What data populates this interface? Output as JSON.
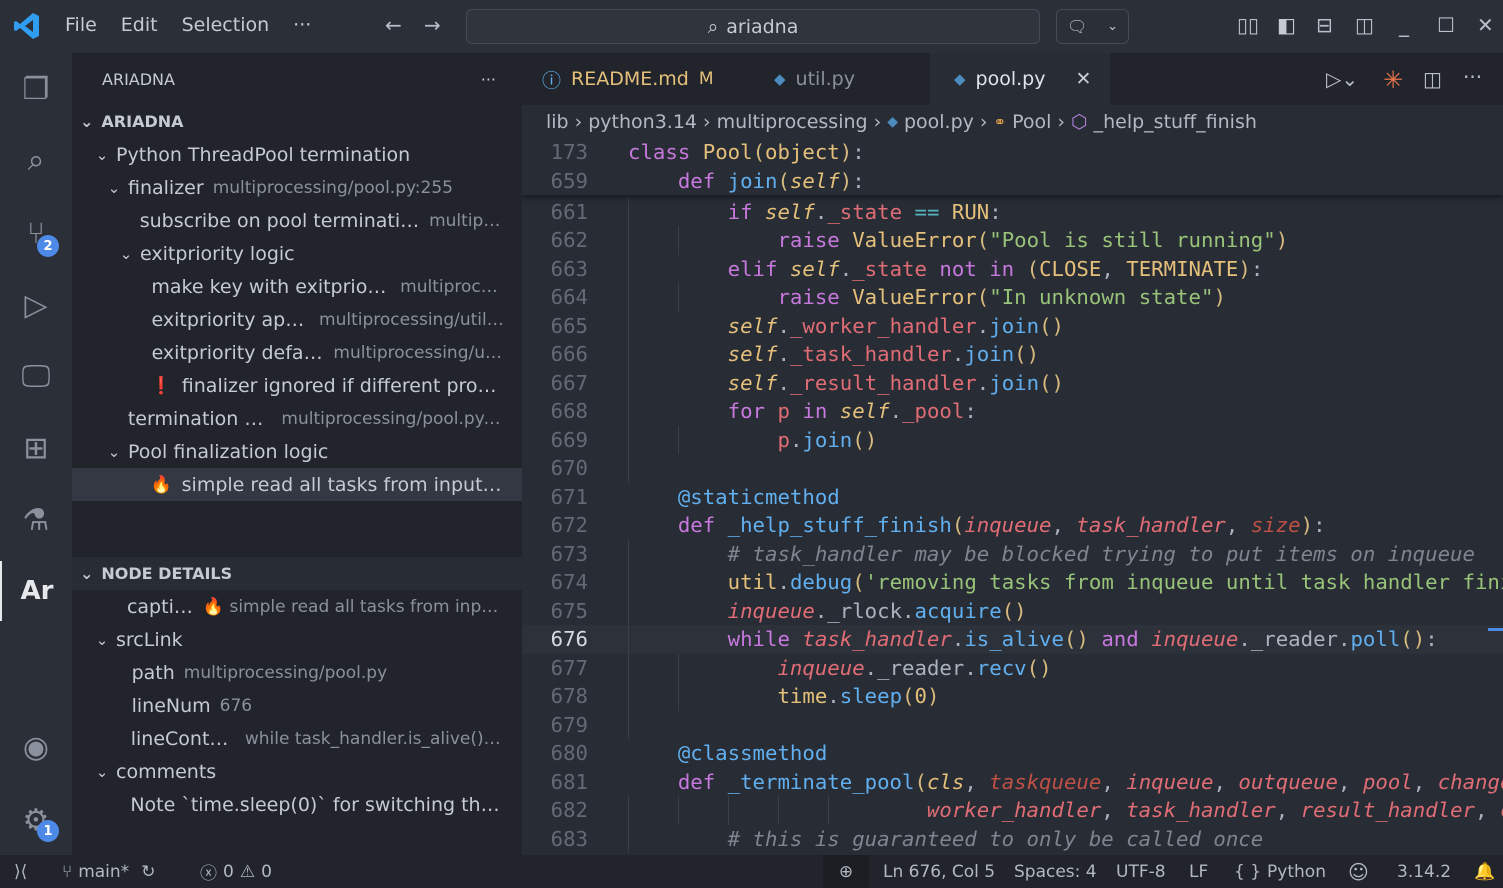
{
  "titlebar": {
    "menus": [
      "File",
      "Edit",
      "Selection"
    ],
    "more": "···",
    "search": "ariadna"
  },
  "colors": {
    "accent": "#4d8ae8",
    "editor_bg": "#282c34",
    "sidebar_bg": "#21252b",
    "readme_modified": "#e5c07b",
    "claude_icon": "#e8744a"
  },
  "activity": {
    "items": [
      "explorer-icon",
      "search-icon",
      "source-control-icon",
      "run-debug-icon",
      "remote-explorer-icon",
      "extensions-icon",
      "testing-icon",
      "ariadna-icon"
    ],
    "scm_badge": "2",
    "ariadna_label": "Ar",
    "settings_badge": "1"
  },
  "sidebar": {
    "title": "ARIADNA",
    "more": "···",
    "section1": "ARIADNA",
    "tree": [
      {
        "label": "Python ThreadPool termination",
        "desc": "",
        "level": 0,
        "expanded": true
      },
      {
        "label": "finalizer",
        "desc": "multiprocessing/pool.py:255",
        "level": 1,
        "expanded": true
      },
      {
        "label": "subscribe on pool termination",
        "desc": "multipr...",
        "level": 2
      },
      {
        "label": "exitpriority logic",
        "desc": "",
        "level": 2,
        "expanded": true
      },
      {
        "label": "make key with exitpriority",
        "desc": "multiproce...",
        "level": 3
      },
      {
        "label": "exitpriority apply",
        "desc": "multiprocessing/util....",
        "level": 3
      },
      {
        "label": "exitpriority default",
        "desc": "multiprocessing/ut...",
        "level": 3
      },
      {
        "label": "finalizer ignored if different proces...",
        "desc": "",
        "level": 3,
        "icon": "❗"
      },
      {
        "label": "termination api",
        "desc": "multiprocessing/pool.py:...",
        "level": 1
      },
      {
        "label": "Pool finalization logic",
        "desc": "",
        "level": 1,
        "expanded": true
      },
      {
        "label": "simple read all tasks from input qu...",
        "desc": "",
        "level": 3,
        "icon": "🔥",
        "selected": true
      }
    ],
    "section2": "NODE DETAILS",
    "details": [
      {
        "label": "caption",
        "desc": "🔥 simple read all tasks from input ...",
        "level": 1
      },
      {
        "label": "srcLink",
        "desc": "",
        "level": 0,
        "expanded": true
      },
      {
        "label": "path",
        "desc": "multiprocessing/pool.py",
        "level": 1.3
      },
      {
        "label": "lineNum",
        "desc": "676",
        "level": 1.3
      },
      {
        "label": "lineContent",
        "desc": "while task_handler.is_alive() a...",
        "level": 1.3
      },
      {
        "label": "comments",
        "desc": "",
        "level": 0,
        "expanded": true
      },
      {
        "label": "Note `time.sleep(0)` for switching threa...",
        "desc": "",
        "level": 1.3
      }
    ]
  },
  "tabs": [
    {
      "label": "README.md",
      "badge": "M",
      "icon": "ⓘ"
    },
    {
      "label": "util.py",
      "icon": "python"
    },
    {
      "label": "pool.py",
      "icon": "python",
      "active": true,
      "close": "✕"
    }
  ],
  "breadcrumb": [
    "lib",
    "python3.14",
    "multiprocessing",
    "pool.py",
    "Pool",
    "_help_stuff_finish"
  ],
  "editor": {
    "current_line": "676",
    "sticky": [
      {
        "n": "173",
        "t": [
          [
            "class ",
            "k"
          ],
          [
            "Pool",
            "c"
          ],
          [
            "(",
            "b"
          ],
          [
            "object",
            "c"
          ],
          [
            ")",
            "b"
          ],
          [
            ":",
            "p"
          ]
        ]
      },
      {
        "n": "659",
        "t": [
          [
            "    def ",
            "k"
          ],
          [
            "join",
            "f"
          ],
          [
            "(",
            "b"
          ],
          [
            "self",
            "si"
          ],
          [
            ")",
            "b"
          ],
          [
            ":",
            "p"
          ]
        ]
      }
    ],
    "lines": [
      {
        "n": "661",
        "t": [
          [
            "        if ",
            "k"
          ],
          [
            "self",
            "si"
          ],
          [
            ".",
            "p"
          ],
          [
            "_state",
            "v"
          ],
          [
            " == ",
            "o"
          ],
          [
            "RUN",
            "c"
          ],
          [
            ":",
            "p"
          ]
        ]
      },
      {
        "n": "662",
        "t": [
          [
            "            raise ",
            "k"
          ],
          [
            "ValueError",
            "c"
          ],
          [
            "(",
            "b"
          ],
          [
            "\"Pool is still running\"",
            "s"
          ],
          [
            ")",
            "b"
          ]
        ]
      },
      {
        "n": "663",
        "t": [
          [
            "        elif ",
            "k"
          ],
          [
            "self",
            "si"
          ],
          [
            ".",
            "p"
          ],
          [
            "_state",
            "v"
          ],
          [
            " not in ",
            "k"
          ],
          [
            "(",
            "b"
          ],
          [
            "CLOSE",
            "c"
          ],
          [
            ", ",
            "p"
          ],
          [
            "TERMINATE",
            "c"
          ],
          [
            ")",
            "b"
          ],
          [
            ":",
            "p"
          ]
        ]
      },
      {
        "n": "664",
        "t": [
          [
            "            raise ",
            "k"
          ],
          [
            "ValueError",
            "c"
          ],
          [
            "(",
            "b"
          ],
          [
            "\"In unknown state\"",
            "s"
          ],
          [
            ")",
            "b"
          ]
        ]
      },
      {
        "n": "665",
        "t": [
          [
            "        ",
            "p"
          ],
          [
            "self",
            "si"
          ],
          [
            ".",
            "p"
          ],
          [
            "_worker_handler",
            "v"
          ],
          [
            ".",
            "p"
          ],
          [
            "join",
            "f"
          ],
          [
            "()",
            "b"
          ]
        ]
      },
      {
        "n": "666",
        "t": [
          [
            "        ",
            "p"
          ],
          [
            "self",
            "si"
          ],
          [
            ".",
            "p"
          ],
          [
            "_task_handler",
            "v"
          ],
          [
            ".",
            "p"
          ],
          [
            "join",
            "f"
          ],
          [
            "()",
            "b"
          ]
        ]
      },
      {
        "n": "667",
        "t": [
          [
            "        ",
            "p"
          ],
          [
            "self",
            "si"
          ],
          [
            ".",
            "p"
          ],
          [
            "_result_handler",
            "v"
          ],
          [
            ".",
            "p"
          ],
          [
            "join",
            "f"
          ],
          [
            "()",
            "b"
          ]
        ]
      },
      {
        "n": "668",
        "t": [
          [
            "        for ",
            "k"
          ],
          [
            "p",
            "v"
          ],
          [
            " in ",
            "k"
          ],
          [
            "self",
            "si"
          ],
          [
            ".",
            "p"
          ],
          [
            "_pool",
            "v"
          ],
          [
            ":",
            "p"
          ]
        ]
      },
      {
        "n": "669",
        "t": [
          [
            "            ",
            "p"
          ],
          [
            "p",
            "v"
          ],
          [
            ".",
            "p"
          ],
          [
            "join",
            "f"
          ],
          [
            "()",
            "b"
          ]
        ]
      },
      {
        "n": "670",
        "t": []
      },
      {
        "n": "671",
        "t": [
          [
            "    @staticmethod",
            "d"
          ]
        ]
      },
      {
        "n": "672",
        "t": [
          [
            "    def ",
            "k"
          ],
          [
            "_help_stuff_finish",
            "f"
          ],
          [
            "(",
            "b"
          ],
          [
            "inqueue",
            "pi"
          ],
          [
            ", ",
            "p"
          ],
          [
            "task_handler",
            "pi"
          ],
          [
            ", ",
            "p"
          ],
          [
            "size",
            "pd"
          ],
          [
            ")",
            "b"
          ],
          [
            ":",
            "p"
          ]
        ]
      },
      {
        "n": "673",
        "t": [
          [
            "        # task_handler may be blocked trying to put items on inqueue",
            "cm"
          ]
        ]
      },
      {
        "n": "674",
        "t": [
          [
            "        util",
            "c"
          ],
          [
            ".",
            "p"
          ],
          [
            "debug",
            "f"
          ],
          [
            "(",
            "b"
          ],
          [
            "'removing tasks from inqueue until task handler finished'",
            "s"
          ],
          [
            ")",
            "b"
          ]
        ]
      },
      {
        "n": "675",
        "t": [
          [
            "        ",
            "p"
          ],
          [
            "inqueue",
            "pi"
          ],
          [
            ".",
            "p"
          ],
          [
            "_rlock",
            "p"
          ],
          [
            ".",
            "p"
          ],
          [
            "acquire",
            "f"
          ],
          [
            "()",
            "b"
          ]
        ]
      },
      {
        "n": "676",
        "t": [
          [
            "        while ",
            "k"
          ],
          [
            "task_handler",
            "pi"
          ],
          [
            ".",
            "p"
          ],
          [
            "is_alive",
            "f"
          ],
          [
            "()",
            "b"
          ],
          [
            " and ",
            "k"
          ],
          [
            "inqueue",
            "pi"
          ],
          [
            ".",
            "p"
          ],
          [
            "_reader",
            "p"
          ],
          [
            ".",
            "p"
          ],
          [
            "poll",
            "f"
          ],
          [
            "()",
            "b"
          ],
          [
            ":",
            "p"
          ]
        ]
      },
      {
        "n": "677",
        "t": [
          [
            "            ",
            "p"
          ],
          [
            "inqueue",
            "pi"
          ],
          [
            ".",
            "p"
          ],
          [
            "_reader",
            "p"
          ],
          [
            ".",
            "p"
          ],
          [
            "recv",
            "f"
          ],
          [
            "()",
            "b"
          ]
        ]
      },
      {
        "n": "678",
        "t": [
          [
            "            time",
            "c"
          ],
          [
            ".",
            "p"
          ],
          [
            "sleep",
            "f"
          ],
          [
            "(",
            "b"
          ],
          [
            "0",
            "c"
          ],
          [
            ")",
            "b"
          ]
        ]
      },
      {
        "n": "679",
        "t": []
      },
      {
        "n": "680",
        "t": [
          [
            "    @classmethod",
            "d"
          ]
        ]
      },
      {
        "n": "681",
        "t": [
          [
            "    def ",
            "k"
          ],
          [
            "_terminate_pool",
            "f"
          ],
          [
            "(",
            "b"
          ],
          [
            "cls",
            "si"
          ],
          [
            ", ",
            "p"
          ],
          [
            "taskqueue",
            "pd"
          ],
          [
            ", ",
            "p"
          ],
          [
            "inqueue",
            "pi"
          ],
          [
            ", ",
            "p"
          ],
          [
            "outqueue",
            "pi"
          ],
          [
            ", ",
            "p"
          ],
          [
            "pool",
            "pi"
          ],
          [
            ", ",
            "p"
          ],
          [
            "change_notifier",
            "pi"
          ],
          [
            ",",
            "p"
          ]
        ]
      },
      {
        "n": "682",
        "t": [
          [
            "                        ",
            "p"
          ],
          [
            "worker_handler",
            "pi"
          ],
          [
            ", ",
            "p"
          ],
          [
            "task_handler",
            "pi"
          ],
          [
            ", ",
            "p"
          ],
          [
            "result_handler",
            "pi"
          ],
          [
            ", ",
            "p"
          ],
          [
            "cache",
            "pi"
          ],
          [
            ")",
            "b"
          ],
          [
            ":",
            "p"
          ]
        ]
      },
      {
        "n": "683",
        "t": [
          [
            "        # this is guaranteed to only be called once",
            "cm"
          ]
        ]
      }
    ]
  },
  "status": {
    "branch": "main*",
    "errors": "0",
    "warnings": "0",
    "position": "Ln 676, Col 5",
    "spaces": "Spaces: 4",
    "encoding": "UTF-8",
    "eol": "LF",
    "language": "Python",
    "language_icon": "{ }",
    "python_version": "3.14.2"
  }
}
